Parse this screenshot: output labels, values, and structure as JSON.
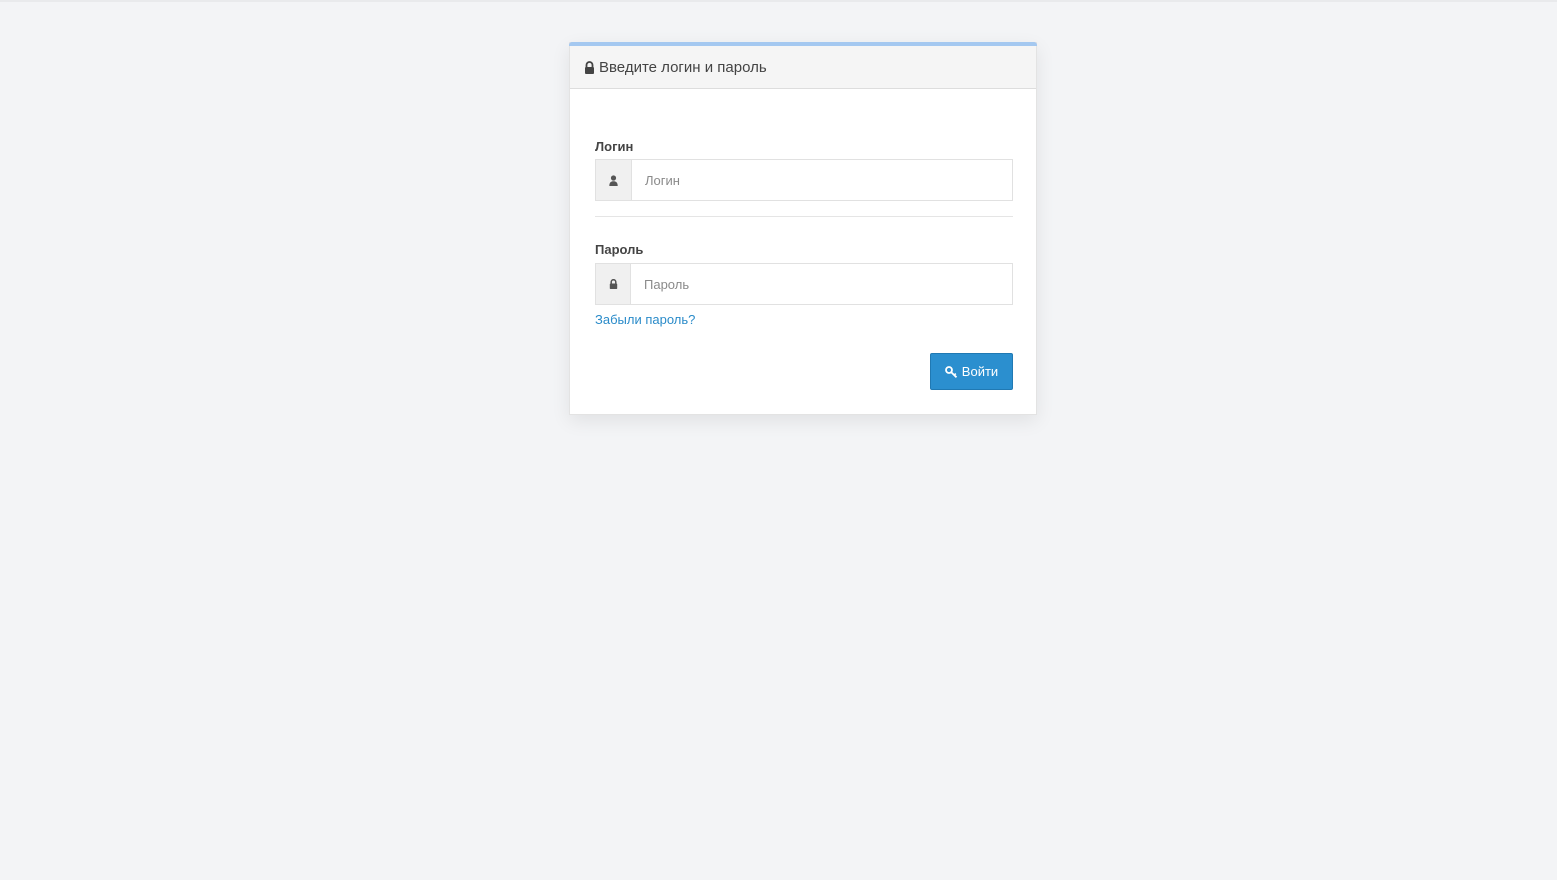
{
  "panel": {
    "heading": "Введите логин и пароль",
    "heading_icon": "lock-icon"
  },
  "form": {
    "login": {
      "label": "Логин",
      "placeholder": "Логин",
      "value": "",
      "icon": "user-icon"
    },
    "password": {
      "label": "Пароль",
      "placeholder": "Пароль",
      "value": "",
      "icon": "lock-icon"
    },
    "forgot_link": "Забыли пароль?",
    "submit_label": "Войти",
    "submit_icon": "key-icon"
  },
  "colors": {
    "accent_bar": "#a4c8f0",
    "button": "#2b8fcf",
    "link": "#2a8bc9",
    "background": "#f3f4f6"
  }
}
